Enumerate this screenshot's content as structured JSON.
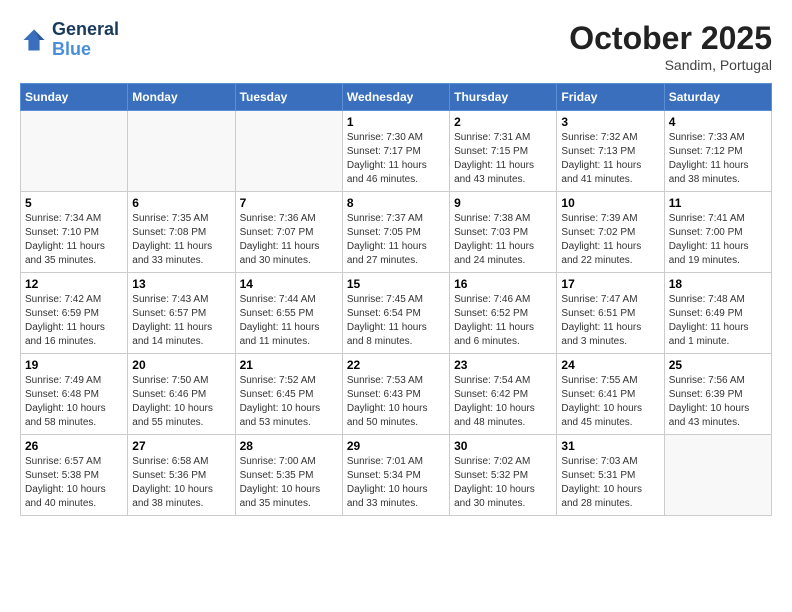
{
  "header": {
    "logo_line1": "General",
    "logo_line2": "Blue",
    "month": "October 2025",
    "location": "Sandim, Portugal"
  },
  "weekdays": [
    "Sunday",
    "Monday",
    "Tuesday",
    "Wednesday",
    "Thursday",
    "Friday",
    "Saturday"
  ],
  "weeks": [
    [
      {
        "day": "",
        "info": ""
      },
      {
        "day": "",
        "info": ""
      },
      {
        "day": "",
        "info": ""
      },
      {
        "day": "1",
        "info": "Sunrise: 7:30 AM\nSunset: 7:17 PM\nDaylight: 11 hours\nand 46 minutes."
      },
      {
        "day": "2",
        "info": "Sunrise: 7:31 AM\nSunset: 7:15 PM\nDaylight: 11 hours\nand 43 minutes."
      },
      {
        "day": "3",
        "info": "Sunrise: 7:32 AM\nSunset: 7:13 PM\nDaylight: 11 hours\nand 41 minutes."
      },
      {
        "day": "4",
        "info": "Sunrise: 7:33 AM\nSunset: 7:12 PM\nDaylight: 11 hours\nand 38 minutes."
      }
    ],
    [
      {
        "day": "5",
        "info": "Sunrise: 7:34 AM\nSunset: 7:10 PM\nDaylight: 11 hours\nand 35 minutes."
      },
      {
        "day": "6",
        "info": "Sunrise: 7:35 AM\nSunset: 7:08 PM\nDaylight: 11 hours\nand 33 minutes."
      },
      {
        "day": "7",
        "info": "Sunrise: 7:36 AM\nSunset: 7:07 PM\nDaylight: 11 hours\nand 30 minutes."
      },
      {
        "day": "8",
        "info": "Sunrise: 7:37 AM\nSunset: 7:05 PM\nDaylight: 11 hours\nand 27 minutes."
      },
      {
        "day": "9",
        "info": "Sunrise: 7:38 AM\nSunset: 7:03 PM\nDaylight: 11 hours\nand 24 minutes."
      },
      {
        "day": "10",
        "info": "Sunrise: 7:39 AM\nSunset: 7:02 PM\nDaylight: 11 hours\nand 22 minutes."
      },
      {
        "day": "11",
        "info": "Sunrise: 7:41 AM\nSunset: 7:00 PM\nDaylight: 11 hours\nand 19 minutes."
      }
    ],
    [
      {
        "day": "12",
        "info": "Sunrise: 7:42 AM\nSunset: 6:59 PM\nDaylight: 11 hours\nand 16 minutes."
      },
      {
        "day": "13",
        "info": "Sunrise: 7:43 AM\nSunset: 6:57 PM\nDaylight: 11 hours\nand 14 minutes."
      },
      {
        "day": "14",
        "info": "Sunrise: 7:44 AM\nSunset: 6:55 PM\nDaylight: 11 hours\nand 11 minutes."
      },
      {
        "day": "15",
        "info": "Sunrise: 7:45 AM\nSunset: 6:54 PM\nDaylight: 11 hours\nand 8 minutes."
      },
      {
        "day": "16",
        "info": "Sunrise: 7:46 AM\nSunset: 6:52 PM\nDaylight: 11 hours\nand 6 minutes."
      },
      {
        "day": "17",
        "info": "Sunrise: 7:47 AM\nSunset: 6:51 PM\nDaylight: 11 hours\nand 3 minutes."
      },
      {
        "day": "18",
        "info": "Sunrise: 7:48 AM\nSunset: 6:49 PM\nDaylight: 11 hours\nand 1 minute."
      }
    ],
    [
      {
        "day": "19",
        "info": "Sunrise: 7:49 AM\nSunset: 6:48 PM\nDaylight: 10 hours\nand 58 minutes."
      },
      {
        "day": "20",
        "info": "Sunrise: 7:50 AM\nSunset: 6:46 PM\nDaylight: 10 hours\nand 55 minutes."
      },
      {
        "day": "21",
        "info": "Sunrise: 7:52 AM\nSunset: 6:45 PM\nDaylight: 10 hours\nand 53 minutes."
      },
      {
        "day": "22",
        "info": "Sunrise: 7:53 AM\nSunset: 6:43 PM\nDaylight: 10 hours\nand 50 minutes."
      },
      {
        "day": "23",
        "info": "Sunrise: 7:54 AM\nSunset: 6:42 PM\nDaylight: 10 hours\nand 48 minutes."
      },
      {
        "day": "24",
        "info": "Sunrise: 7:55 AM\nSunset: 6:41 PM\nDaylight: 10 hours\nand 45 minutes."
      },
      {
        "day": "25",
        "info": "Sunrise: 7:56 AM\nSunset: 6:39 PM\nDaylight: 10 hours\nand 43 minutes."
      }
    ],
    [
      {
        "day": "26",
        "info": "Sunrise: 6:57 AM\nSunset: 5:38 PM\nDaylight: 10 hours\nand 40 minutes."
      },
      {
        "day": "27",
        "info": "Sunrise: 6:58 AM\nSunset: 5:36 PM\nDaylight: 10 hours\nand 38 minutes."
      },
      {
        "day": "28",
        "info": "Sunrise: 7:00 AM\nSunset: 5:35 PM\nDaylight: 10 hours\nand 35 minutes."
      },
      {
        "day": "29",
        "info": "Sunrise: 7:01 AM\nSunset: 5:34 PM\nDaylight: 10 hours\nand 33 minutes."
      },
      {
        "day": "30",
        "info": "Sunrise: 7:02 AM\nSunset: 5:32 PM\nDaylight: 10 hours\nand 30 minutes."
      },
      {
        "day": "31",
        "info": "Sunrise: 7:03 AM\nSunset: 5:31 PM\nDaylight: 10 hours\nand 28 minutes."
      },
      {
        "day": "",
        "info": ""
      }
    ]
  ]
}
